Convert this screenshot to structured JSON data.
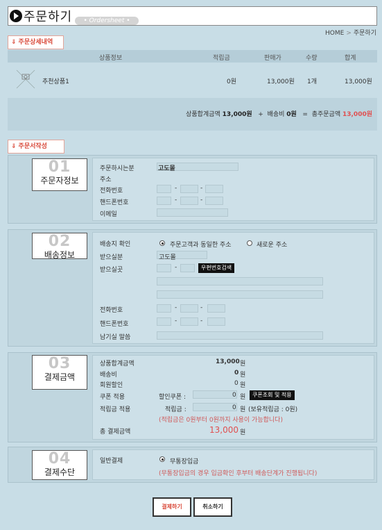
{
  "header": {
    "title": "주문하기",
    "subtitle": "• Ordersheet •",
    "breadcrumb_home": "HOME",
    "breadcrumb_sep": ">",
    "breadcrumb_current": "주문하기"
  },
  "order_details": {
    "section_label": "주문상세내역",
    "columns": [
      "상품정보",
      "적립금",
      "판매가",
      "수량",
      "합계"
    ],
    "items": [
      {
        "thumb_icon": "no-image-thumbnail-icon",
        "name": "추천상품1",
        "points": "0원",
        "price": "13,000원",
        "qty": "1개",
        "total": "13,000원"
      }
    ],
    "summary": {
      "subtotal_label": "상품합계금액",
      "subtotal": "13,000원",
      "plus": "+",
      "shipping_label": "배송비",
      "shipping": "0원",
      "equals": "=",
      "total_label": "총주문금액",
      "total": "13,000원"
    }
  },
  "order_form": {
    "section_label": "주문서작성"
  },
  "buyer": {
    "num": "01",
    "title": "주문자정보",
    "name_label": "주문하시는분",
    "name_value": "고도몰",
    "address_label": "주소",
    "phone_label": "전화번호",
    "mobile_label": "핸드폰번호",
    "email_label": "이메일",
    "dash": "-"
  },
  "shipping": {
    "num": "02",
    "title": "배송정보",
    "confirm_label": "배송지 확인",
    "option_same": "주문고객과 동일한 주소",
    "option_new": "새로운 주소",
    "recipient_label": "받으실분",
    "recipient_value": "고도몰",
    "address_label": "받으실곳",
    "zip_button": "우편번호검색",
    "phone_label": "전화번호",
    "mobile_label": "핸드폰번호",
    "message_label": "남기실 말씀",
    "dash": "-"
  },
  "payment_amount": {
    "num": "03",
    "title": "결제금액",
    "subtotal_label": "상품합계금액",
    "subtotal_value": "13,000",
    "shipping_label": "배송비",
    "shipping_value": "0",
    "member_discount_label": "회원할인",
    "member_discount_value": "0",
    "unit": "원",
    "coupon_label": "쿠폰 적용",
    "coupon_field_label": "할인쿠폰 :",
    "coupon_value": "0",
    "coupon_button": "쿠폰조회 및 적용",
    "points_label": "적립금 적용",
    "points_field_label": "적립금 :",
    "points_value": "0",
    "points_owned": "(보유적립금 : 0원)",
    "points_note": "(적립금은 0원부터 0원까지 사용이 가능합니다)",
    "total_label": "총 결제금액",
    "total_value": "13,000"
  },
  "payment_method": {
    "num": "04",
    "title": "결제수단",
    "general_label": "일반결제",
    "option_bank": "무통장입금",
    "note": "(무통장입금의 경우 입금확인 후부터 배송단계가 진행됩니다)"
  },
  "actions": {
    "pay_label": "결제하기",
    "cancel_label": "취소하기"
  },
  "colors": {
    "background": "#c8dde6",
    "accent_red": "#d94a3a",
    "total_red": "#e05050"
  }
}
